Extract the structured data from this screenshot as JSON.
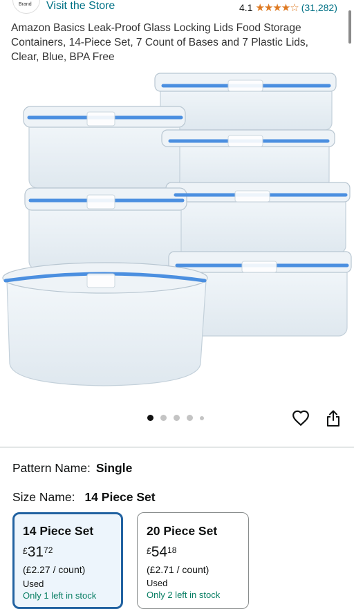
{
  "header": {
    "logo_text": "Brand",
    "store_link": "Visit the Store",
    "rating_value": "4.1",
    "stars": "★★★★☆",
    "review_count": "(31,282)"
  },
  "product": {
    "title": "Amazon Basics Leak-Proof Glass Locking Lids Food Storage Containers, 14-Piece Set, 7 Count of Bases and 7 Plastic Lids, Clear, Blue, BPA Free"
  },
  "gallery": {
    "dot_count": 5,
    "active_index": 0
  },
  "pattern": {
    "label": "Pattern Name:",
    "value": "Single"
  },
  "size": {
    "label": "Size Name:",
    "value": "14 Piece Set",
    "options": [
      {
        "name": "14 Piece Set",
        "currency": "£",
        "whole": "31",
        "fraction": "72",
        "unit_price": "(£2.27 / count)",
        "condition": "Used",
        "stock": "Only 1 left in stock"
      },
      {
        "name": "20 Piece Set",
        "currency": "£",
        "whole": "54",
        "fraction": "18",
        "unit_price": "(£2.71 / count)",
        "condition": "Used",
        "stock": "Only 2 left in stock"
      }
    ]
  },
  "colors": {
    "link": "#007185",
    "star": "#de7921",
    "selected_border": "#2162a1",
    "lid_blue": "#4b8fe0"
  }
}
